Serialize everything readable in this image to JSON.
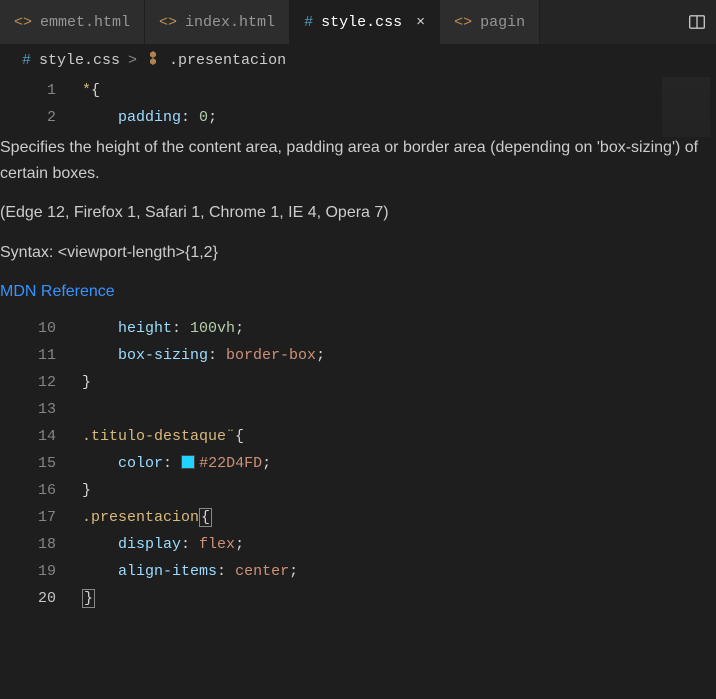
{
  "tabs": [
    {
      "icon": "<>",
      "label": "emmet.html"
    },
    {
      "icon": "<>",
      "label": "index.html"
    },
    {
      "icon": "#",
      "label": "style.css",
      "close": "×"
    },
    {
      "icon": "<>",
      "label": "pagin"
    }
  ],
  "breadcrumb": {
    "icon": "#",
    "file": "style.css",
    "sep": ">",
    "symbol": ".presentacion"
  },
  "hover": {
    "line1": "Specifies the height of the content area, padding area or border area (depending on 'box-sizing') of certain boxes.",
    "line2": "(Edge 12, Firefox 1, Safari 1, Chrome 1, IE 4, Opera 7)",
    "line3": "Syntax: <viewport-length>{1,2}",
    "link": "MDN Reference"
  },
  "lines": {
    "l1_no": "1",
    "l1_sel": "*",
    "l1_br": "{",
    "l2_no": "2",
    "l2_prop": "padding",
    "l2_colon": ":",
    "l2_val": " 0",
    "l2_semi": ";",
    "l10_no": "10",
    "l10_prop": "height",
    "l10_colon": ":",
    "l10_val": " 100vh",
    "l10_semi": ";",
    "l11_no": "11",
    "l11_prop": "box-sizing",
    "l11_colon": ":",
    "l11_val": " border-box",
    "l11_semi": ";",
    "l12_no": "12",
    "l12_br": "}",
    "l13_no": "13",
    "l14_no": "14",
    "l14_sel": ".titulo-destaque¨",
    "l14_br": "{",
    "l15_no": "15",
    "l15_prop": "color",
    "l15_colon": ":",
    "l15_val": "#22D4FD",
    "l15_semi": ";",
    "l16_no": "16",
    "l16_br": "}",
    "l17_no": "17",
    "l17_sel": ".presentacion",
    "l17_br": "{",
    "l18_no": "18",
    "l18_prop": "display",
    "l18_colon": ":",
    "l18_val": " flex",
    "l18_semi": ";",
    "l19_no": "19",
    "l19_prop": "align-items",
    "l19_colon": ":",
    "l19_val": " center",
    "l19_semi": ";",
    "l20_no": "20",
    "l20_br": "}"
  }
}
